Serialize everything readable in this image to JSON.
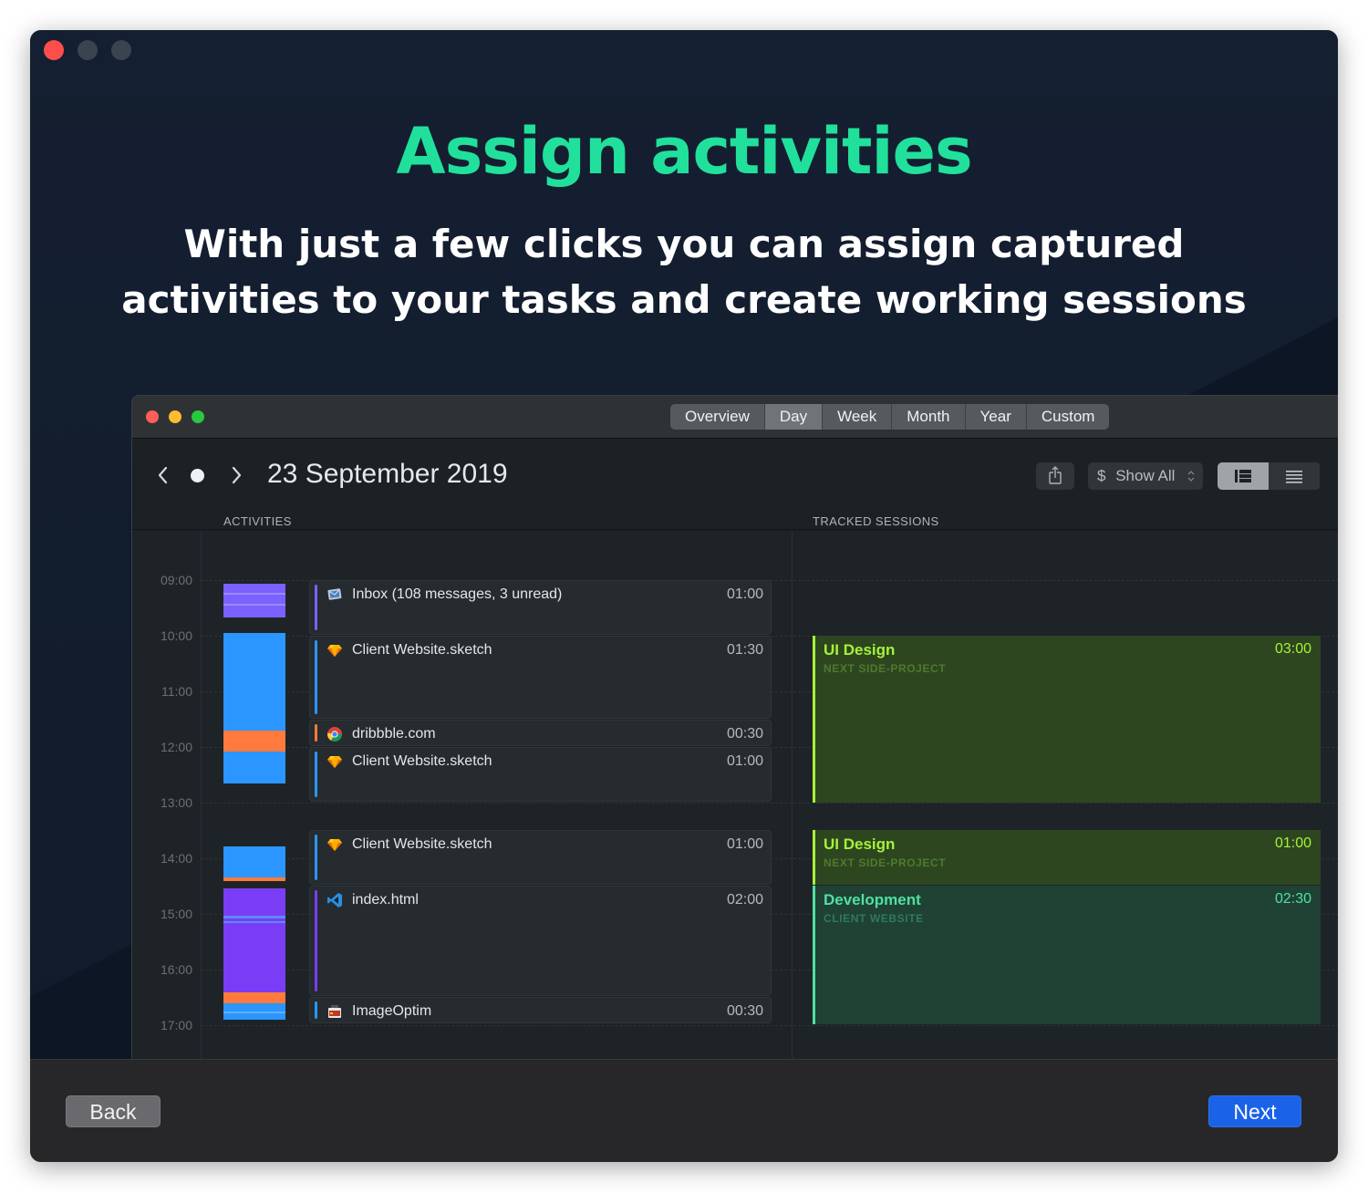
{
  "hero": {
    "title": "Assign activities",
    "subtitle_line1": "With just a few clicks you can assign captured",
    "subtitle_line2": "activities to your tasks and create working sessions"
  },
  "app": {
    "tabs": [
      "Overview",
      "Day",
      "Week",
      "Month",
      "Year",
      "Custom"
    ],
    "active_tab": "Day",
    "date_title": "23 September 2019",
    "filter": {
      "currency": "$",
      "label": "Show All"
    },
    "columns": {
      "activities": "ACTIVITIES",
      "sessions": "TRACKED SESSIONS"
    },
    "time_labels": [
      "09:00",
      "10:00",
      "11:00",
      "12:00",
      "13:00",
      "14:00",
      "15:00",
      "16:00",
      "17:00"
    ],
    "activities": [
      {
        "name": "Inbox (108 messages, 3 unread)",
        "duration": "01:00",
        "icon": "mail-icon",
        "color": "#7b61ff"
      },
      {
        "name": "Client Website.sketch",
        "duration": "01:30",
        "icon": "sketch-icon",
        "color": "#2b96ff"
      },
      {
        "name": "dribbble.com",
        "duration": "00:30",
        "icon": "chrome-icon",
        "color": "#ff7a3c"
      },
      {
        "name": "Client Website.sketch",
        "duration": "01:00",
        "icon": "sketch-icon",
        "color": "#2b96ff"
      },
      {
        "name": "Client Website.sketch",
        "duration": "01:00",
        "icon": "sketch-icon",
        "color": "#2b96ff"
      },
      {
        "name": "index.html",
        "duration": "02:00",
        "icon": "vscode-icon",
        "color": "#7a3df5"
      },
      {
        "name": "ImageOptim",
        "duration": "00:30",
        "icon": "imageoptim-icon",
        "color": "#2b96ff"
      }
    ],
    "sessions": [
      {
        "title": "UI Design",
        "project": "NEXT SIDE-PROJECT",
        "duration": "03:00"
      },
      {
        "title": "UI Design",
        "project": "NEXT SIDE-PROJECT",
        "duration": "01:00"
      },
      {
        "title": "Development",
        "project": "CLIENT WEBSITE",
        "duration": "02:30"
      }
    ]
  },
  "footer": {
    "back_label": "Back",
    "next_label": "Next"
  },
  "colors": {
    "accent": "#21e09c",
    "next_button": "#1a62e8",
    "session_green": "#a6f23a",
    "session_teal": "#4fe0a0"
  }
}
